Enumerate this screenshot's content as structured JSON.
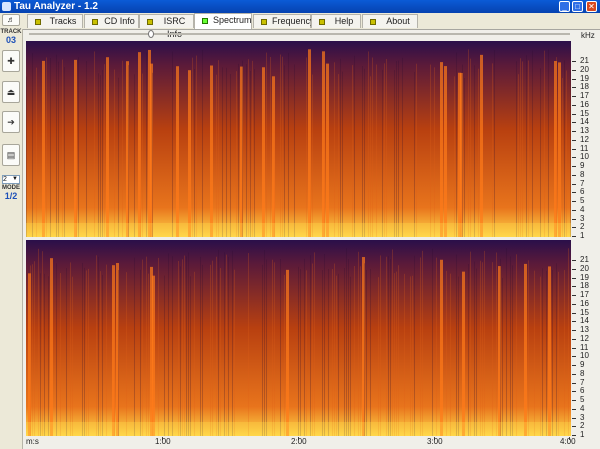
{
  "window": {
    "title": "Tau Analyzer - 1.2",
    "minimize_glyph": "_",
    "maximize_glyph": "□",
    "close_glyph": "✕"
  },
  "tabs": [
    {
      "label": "Tracks",
      "active": false
    },
    {
      "label": "CD Info",
      "active": false
    },
    {
      "label": "ISRC Info",
      "active": false
    },
    {
      "label": "Spectrum",
      "active": true
    },
    {
      "label": "Frequency",
      "active": false
    },
    {
      "label": "Help",
      "active": false
    },
    {
      "label": "About",
      "active": false
    }
  ],
  "sidebar": {
    "track_label": "TRACK",
    "track_value": "03",
    "mode_label": "MODE",
    "mode_value": "1/2",
    "channel_select": "2",
    "buttons": [
      {
        "icon": "add-icon",
        "glyph": "✚"
      },
      {
        "icon": "eject-icon",
        "glyph": "⏏"
      },
      {
        "icon": "forward-icon",
        "glyph": "➔"
      },
      {
        "icon": "display-icon",
        "glyph": "▤"
      }
    ]
  },
  "frequency_axis": {
    "unit": "kHz",
    "labels": [
      "21",
      "20",
      "19",
      "18",
      "17",
      "16",
      "15",
      "14",
      "13",
      "12",
      "11",
      "10",
      "9",
      "8",
      "7",
      "6",
      "5",
      "4",
      "3",
      "2",
      "1"
    ]
  },
  "time_axis": {
    "unit_label": "m:s",
    "labels": [
      "1:00",
      "2:00",
      "3:00",
      "4:00"
    ]
  },
  "colors": {
    "spectrum_low": "#2a0f4a",
    "spectrum_mid": "#b84010",
    "spectrum_high": "#ffd84a",
    "active_tab_lamp": "#66ff33",
    "tab_lamp": "#c9c000",
    "accent_blue": "#1d50b8"
  }
}
